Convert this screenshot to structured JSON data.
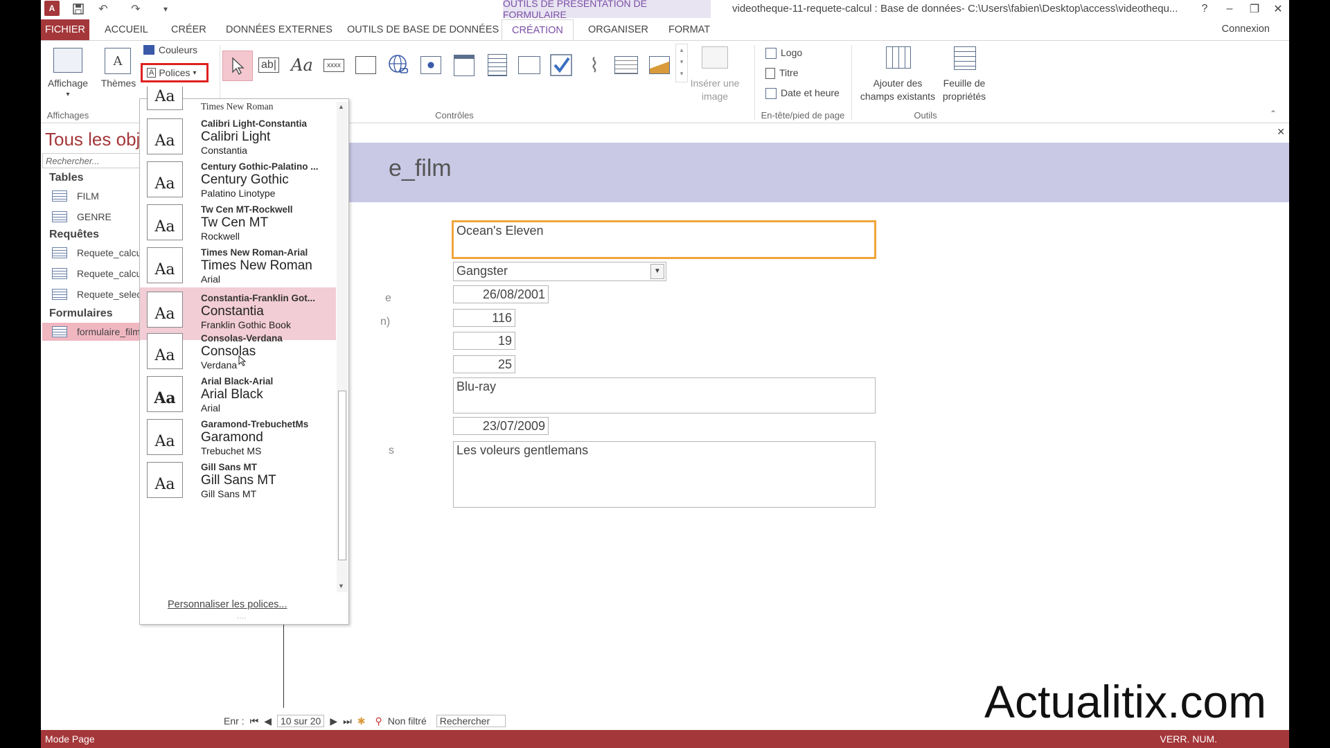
{
  "title_bar": {
    "context_tab": "OUTILS DE PRÉSENTATION DE FORMULAIRE",
    "window_title": "videotheque-11-requete-calcul : Base de données- C:\\Users\\fabien\\Desktop\\access\\videothequ...",
    "help": "?",
    "minimize": "–",
    "restore": "❐",
    "close": "✕"
  },
  "tabs": {
    "fichier": "FICHIER",
    "accueil": "ACCUEIL",
    "creer": "CRÉER",
    "donnees_externes": "DONNÉES EXTERNES",
    "outils_bdd": "OUTILS DE BASE DE DONNÉES",
    "creation": "CRÉATION",
    "organiser": "ORGANISER",
    "format": "FORMAT",
    "connexion": "Connexion"
  },
  "ribbon": {
    "affichage": "Affichage",
    "affichages_group": "Affichages",
    "themes": "Thèmes",
    "couleurs": "Couleurs",
    "polices": "Polices",
    "controles_group": "Contrôles",
    "inserer_image_1": "Insérer une",
    "inserer_image_2": "image",
    "logo": "Logo",
    "titre": "Titre",
    "date_heure": "Date et heure",
    "entete_group": "En-tête/pied de page",
    "ajouter_champs_1": "Ajouter des",
    "ajouter_champs_2": "champs existants",
    "feuille_prop_1": "Feuille de",
    "feuille_prop_2": "propriétés",
    "outils_group": "Outils",
    "ctrl_text": "ab|",
    "ctrl_label": "Aa",
    "ctrl_button": "xxxx"
  },
  "nav": {
    "title": "Tous les obj",
    "search_placeholder": "Rechercher...",
    "sections": {
      "tables": "Tables",
      "requetes": "Requêtes",
      "formulaires": "Formulaires"
    },
    "tables": [
      "FILM",
      "GENRE"
    ],
    "requetes": [
      "Requete_calcu",
      "Requete_calcu",
      "Requete_selec"
    ],
    "formulaires": [
      "formulaire_film"
    ]
  },
  "form": {
    "title": "e_film",
    "titre_film": "Ocean's Eleven",
    "genre": "Gangster",
    "date_sortie": "26/08/2001",
    "duree": "116",
    "val1": "19",
    "val2": "25",
    "support": "Blu-ray",
    "date_achat": "23/07/2009",
    "resume": "Les voleurs gentlemans",
    "label_e": "e",
    "label_n": "n)",
    "label_s": "s"
  },
  "fonts_dropdown": {
    "partial_top": "Times New Roman",
    "aa_glyph": "Aa",
    "items": [
      {
        "name": "Calibri Light-Constantia",
        "heading": "Calibri Light",
        "body": "Constantia"
      },
      {
        "name": "Century Gothic-Palatino ...",
        "heading": "Century Gothic",
        "body": "Palatino Linotype"
      },
      {
        "name": "Tw Cen MT-Rockwell",
        "heading": "Tw Cen MT",
        "body": "Rockwell"
      },
      {
        "name": "Times New Roman-Arial",
        "heading": "Times New Roman",
        "body": "Arial"
      },
      {
        "name": "Constantia-Franklin Got...",
        "heading": "Constantia",
        "body": "Franklin Gothic Book"
      },
      {
        "name": "Consolas-Verdana",
        "heading": "Consolas",
        "body": "Verdana"
      },
      {
        "name": "Arial Black-Arial",
        "heading": "Arial Black",
        "body": "Arial"
      },
      {
        "name": "Garamond-TrebuchetMs",
        "heading": "Garamond",
        "body": "Trebuchet MS"
      },
      {
        "name": "Gill Sans MT",
        "heading": "Gill Sans MT",
        "body": "Gill Sans MT"
      }
    ],
    "customize": "Personnaliser les polices..."
  },
  "record_nav": {
    "label": "Enr :",
    "position": "10 sur 20",
    "filter": "Non filtré",
    "search": "Rechercher"
  },
  "status": {
    "mode": "Mode Page",
    "num": "VERR. NUM."
  },
  "watermark": "Actualitix.com",
  "colors": {
    "accent": "#a4373a",
    "context": "#7b4fa6",
    "form_header": "#c9c9e6",
    "focus_border": "#f0a53a",
    "highlight": "#f2cdd5"
  }
}
